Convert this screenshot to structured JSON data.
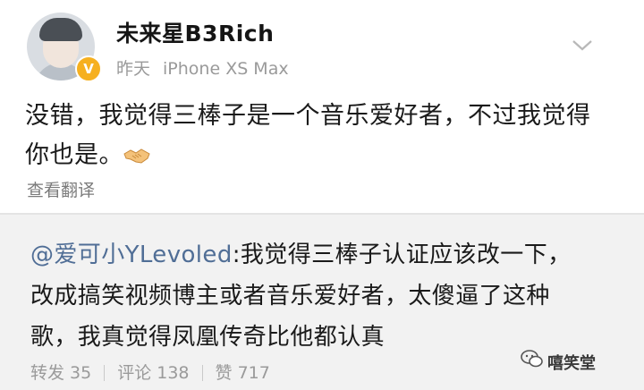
{
  "post": {
    "username": "未来星B3Rich",
    "verified_badge": "V",
    "time": "昨天",
    "device": "iPhone XS Max",
    "content_line1": "没错，我觉得三棒子是一个音乐爱好者，不过我觉得",
    "content_line2": "你也是。",
    "emoji": "handshake-icon",
    "translate_label": "查看翻译"
  },
  "repost": {
    "mention": "@爱可小YLevoled",
    "line1_rest": ":我觉得三棒子认证应该改一下，",
    "line2": "改成搞笑视频博主或者音乐爱好者，太傻逼了这种",
    "line3": "歌，我真觉得凤凰传奇比他都认真",
    "stats": {
      "repost": "转发 35",
      "comment": "评论 138",
      "like": "赞 717"
    }
  },
  "watermark": {
    "text": "嘻笑堂"
  },
  "colors": {
    "mention": "#506e96",
    "badge": "#f6b020",
    "meta": "#9a9a9a",
    "repost_bg": "#f2f2f2"
  }
}
